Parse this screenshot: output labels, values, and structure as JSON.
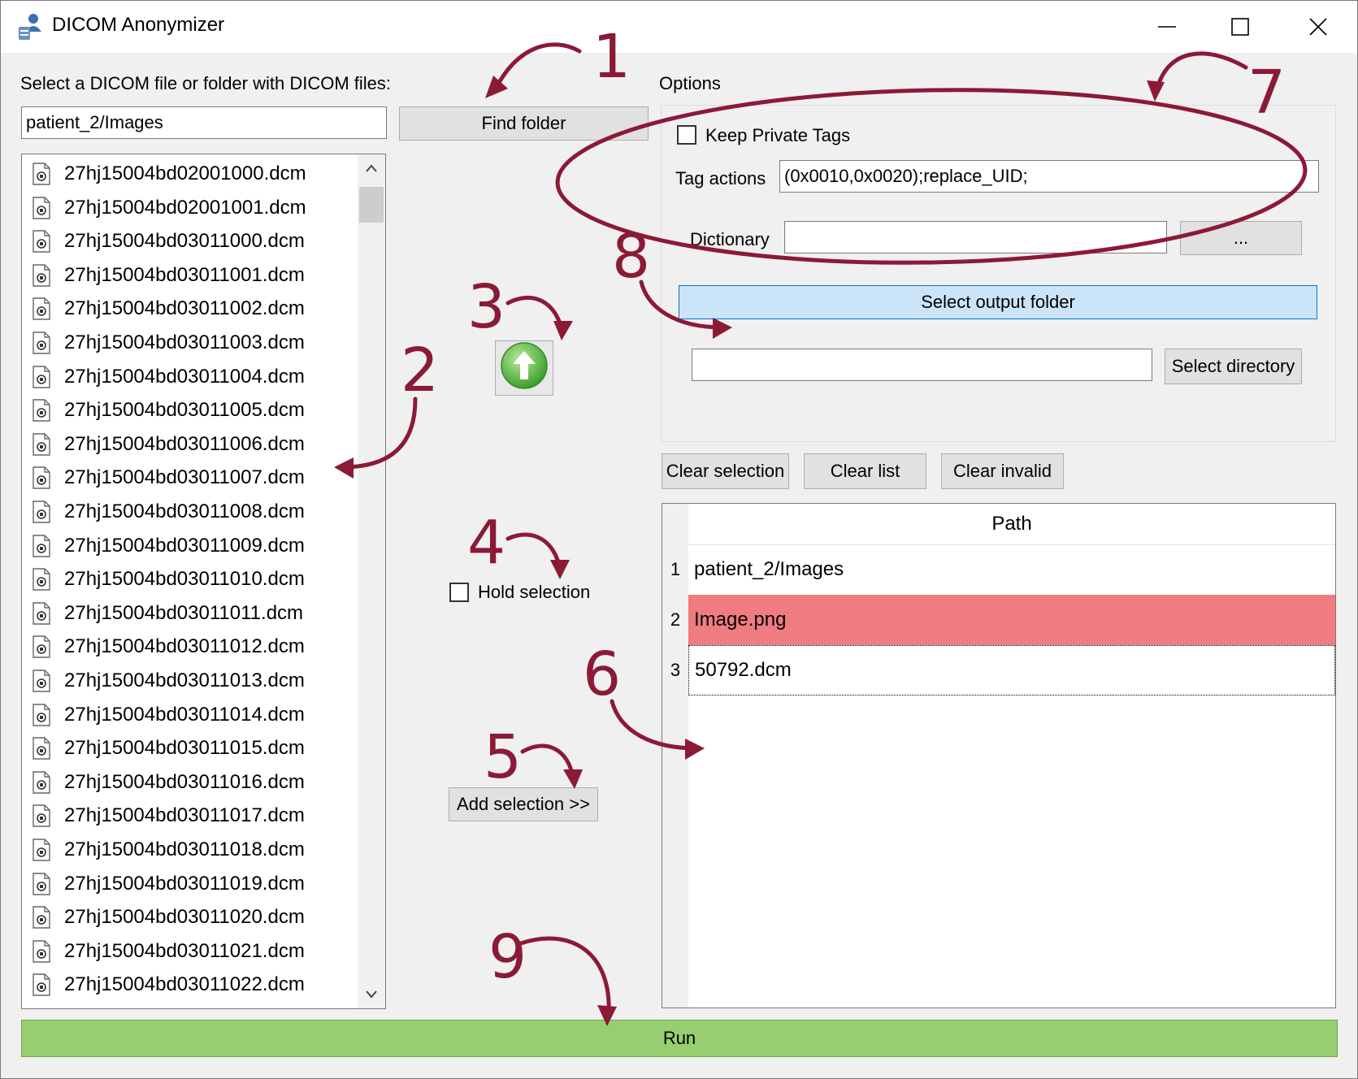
{
  "window": {
    "title": "DICOM Anonymizer",
    "icon": "user-database-icon",
    "controls": [
      "minimize-icon",
      "maximize-icon",
      "close-icon"
    ]
  },
  "source": {
    "label": "Select a DICOM file or folder with DICOM files:",
    "path_value": "patient_2/Images",
    "find_button": "Find folder",
    "files": [
      "27hj15004bd02001000.dcm",
      "27hj15004bd02001001.dcm",
      "27hj15004bd03011000.dcm",
      "27hj15004bd03011001.dcm",
      "27hj15004bd03011002.dcm",
      "27hj15004bd03011003.dcm",
      "27hj15004bd03011004.dcm",
      "27hj15004bd03011005.dcm",
      "27hj15004bd03011006.dcm",
      "27hj15004bd03011007.dcm",
      "27hj15004bd03011008.dcm",
      "27hj15004bd03011009.dcm",
      "27hj15004bd03011010.dcm",
      "27hj15004bd03011011.dcm",
      "27hj15004bd03011012.dcm",
      "27hj15004bd03011013.dcm",
      "27hj15004bd03011014.dcm",
      "27hj15004bd03011015.dcm",
      "27hj15004bd03011016.dcm",
      "27hj15004bd03011017.dcm",
      "27hj15004bd03011018.dcm",
      "27hj15004bd03011019.dcm",
      "27hj15004bd03011020.dcm",
      "27hj15004bd03011021.dcm",
      "27hj15004bd03011022.dcm"
    ]
  },
  "middle": {
    "up_icon": "green-up-arrow-icon",
    "hold_selection_label": "Hold selection",
    "add_selection_button": "Add selection >>"
  },
  "options": {
    "label": "Options",
    "keep_private_tags_label": "Keep Private Tags",
    "tag_actions_label": "Tag actions",
    "tag_actions_value": "(0x0010,0x0020);replace_UID;",
    "dictionary_label": "Dictionary",
    "dictionary_value": "",
    "dictionary_browse": "...",
    "select_output_folder": "Select output folder",
    "output_dir_value": "",
    "select_directory": "Select directory"
  },
  "list_controls": {
    "clear_selection": "Clear selection",
    "clear_list": "Clear list",
    "clear_invalid": "Clear invalid"
  },
  "table": {
    "header": "Path",
    "rows": [
      {
        "num": "1",
        "path": "patient_2/Images"
      },
      {
        "num": "2",
        "path": "Image.png"
      },
      {
        "num": "3",
        "path": "50792.dcm"
      }
    ],
    "invalid_color": "#f07b80"
  },
  "run_button": "Run",
  "annotations": [
    "1",
    "2",
    "3",
    "4",
    "5",
    "6",
    "7",
    "8",
    "9"
  ],
  "colors": {
    "annotation": "#8b1a37",
    "run_green": "#97cf70",
    "output_highlight": "#cce4f7"
  }
}
